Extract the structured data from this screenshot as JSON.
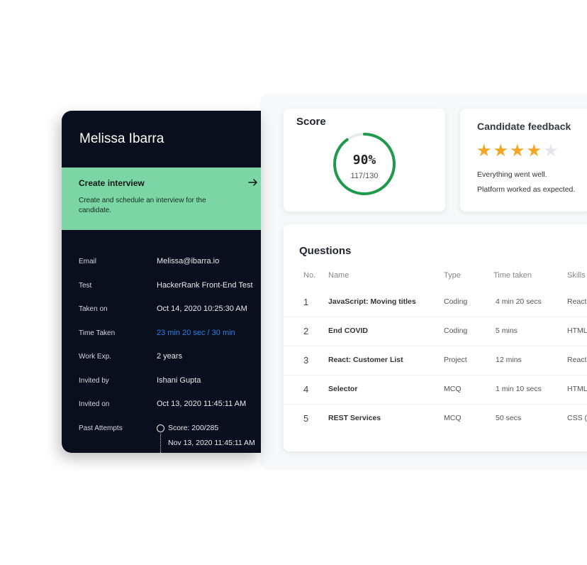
{
  "candidate": {
    "name": "Melissa Ibarra",
    "create_interview": {
      "title": "Create interview",
      "description": "Create and schedule an interview for the candidate."
    },
    "details": [
      {
        "label": "Email",
        "value": "Melissa@ibarra.io"
      },
      {
        "label": "Test",
        "value": "HackerRank Front-End Test"
      },
      {
        "label": "Taken on",
        "value": "Oct 14, 2020  10:25:30 AM"
      },
      {
        "label": "Time Taken",
        "value": "23 min 20 sec / 30 min"
      },
      {
        "label": "Work Exp.",
        "value": "2 years"
      },
      {
        "label": "Invited by",
        "value": "Ishani Gupta"
      },
      {
        "label": "Invited on",
        "value": "Oct 13, 2020  11:45:11 AM"
      },
      {
        "label": "Past Attempts",
        "value": "Score: 200/285"
      }
    ],
    "past_attempt_date": "Nov 13, 2020  11:45:11 AM"
  },
  "score": {
    "title": "Score",
    "percent_label": "90%",
    "fraction_label": "117/130",
    "percent_value": 0.9,
    "ring_color": "#1f9a4c"
  },
  "feedback": {
    "title": "Candidate feedback",
    "rating": 4,
    "max_rating": 5,
    "lines": [
      "Everything went well.",
      "Platform worked as expected."
    ]
  },
  "questions": {
    "title": "Questions",
    "columns": [
      "No.",
      "Name",
      "Type",
      "Time taken",
      "Skills"
    ],
    "rows": [
      {
        "no": "1",
        "name": "JavaScript: Moving titles",
        "type": "Coding",
        "time": "4 min 20 secs",
        "skills": "React"
      },
      {
        "no": "2",
        "name": "End COVID",
        "type": "Coding",
        "time": "5 mins",
        "skills": "HTML"
      },
      {
        "no": "3",
        "name": "React: Customer List",
        "type": "Project",
        "time": "12 mins",
        "skills": "React"
      },
      {
        "no": "4",
        "name": "Selector",
        "type": "MCQ",
        "time": "1 min 10 secs",
        "skills": "HTML"
      },
      {
        "no": "5",
        "name": "REST Services",
        "type": "MCQ",
        "time": "50 secs",
        "skills": "CSS (In"
      }
    ]
  },
  "colors": {
    "dark_bg": "#0a0f1e",
    "accent_green": "#7cd5a5",
    "link_blue": "#2a80e3",
    "star_gold": "#f5a623"
  }
}
